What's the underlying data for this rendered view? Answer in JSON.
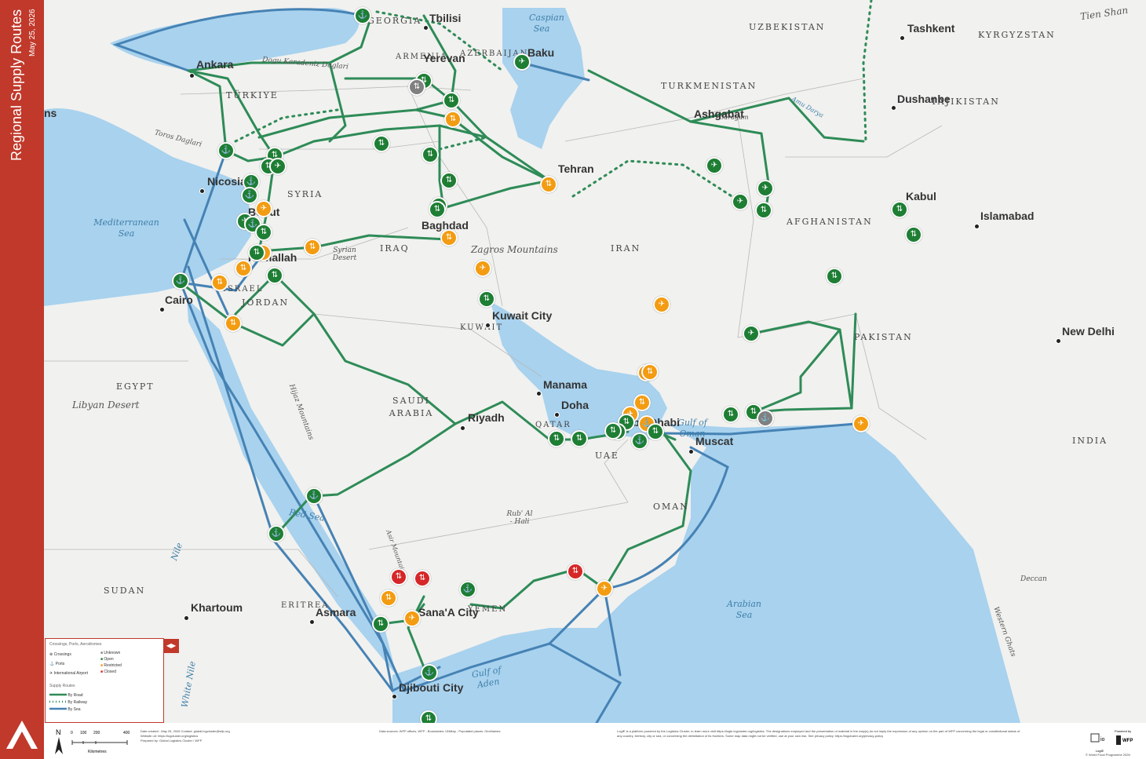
{
  "title": "Regional Supply Routes",
  "date": "May 25, 2026",
  "colors": {
    "road": "#2e8b57",
    "rail": "#2e8b57",
    "sea": "#4682b4",
    "open": "#1e7e34",
    "restricted": "#f39c12",
    "closed": "#d62728",
    "unknown": "#808080",
    "brand": "#c0392b",
    "water": "#a8d2ee",
    "land": "#f1f1ef"
  },
  "cities": [
    "Tbilisi",
    "Yerevan",
    "Baku",
    "Ankara",
    "Tashkent",
    "Dushanbe",
    "Ashgabat",
    "Tehran",
    "Kabul",
    "Islamabad",
    "Nicosia",
    "Beirut",
    "Ramallah",
    "Baghdad",
    "Cairo",
    "Kuwait City",
    "New Delhi",
    "Manama",
    "Doha",
    "Riyadh",
    "Abu Dhabi",
    "Muscat",
    "Khartoum",
    "Asmara",
    "Sana'A City",
    "Djibouti City"
  ],
  "countries": [
    "GEORGIA",
    "ARMENIA",
    "AZERBAIJAN",
    "UZBEKISTAN",
    "KYRGYZSTAN",
    "TURKMENISTAN",
    "TAJIKISTAN",
    "TÜRKIYE",
    "SYRIA",
    "IRAQ",
    "IRAN",
    "AFGHANISTAN",
    "PAKISTAN",
    "ISRAEL",
    "JORDAN",
    "KUWAIT",
    "EGYPT",
    "SAUDI ARABIA",
    "QATAR",
    "UAE",
    "OMAN",
    "INDIA",
    "SUDAN",
    "ERITREA",
    "YEMEN"
  ],
  "water_labels": [
    "Caspian Sea",
    "Mediterranean Sea",
    "Red Sea",
    "Gulf of Oman",
    "Arabian Sea",
    "Gulf of Aden",
    "Nile",
    "White Nile",
    "Amu Darya"
  ],
  "terrain_labels": [
    "Tien Shan",
    "Dogu Karadeniz Daglari",
    "Toros Daglari",
    "Syrian Desert",
    "Zagros Mountains",
    "Libyan Desert",
    "Hijaz Mountains",
    "Rub' Al - Hali",
    "Asir Mountains",
    "Deccan",
    "Western Ghats",
    "Garagum",
    "ns"
  ],
  "legend": {
    "section1": "Crossings, Ports, Aerodromes",
    "types": [
      "Crossings",
      "Ports",
      "International Airport"
    ],
    "statuses": [
      "Unknown",
      "Open",
      "Restricted",
      "Closed"
    ],
    "section2": "Supply Routes",
    "routes": [
      "By Road",
      "By Railway",
      "By Sea"
    ]
  },
  "scale": {
    "ticks": [
      "0",
      "100",
      "200",
      "400"
    ],
    "unit": "Kilometres",
    "north": "N"
  },
  "footer": {
    "created": "Date created : May 25, 2026 Contact: global.logcluster@wfp.org",
    "website": "Website url: https://logcluster.org/logistics",
    "prepared": "Prepared by: Global Logistics Cluster / WFP",
    "sources": "Data sources: WFP offices, WFP - Boundaries: UNMap - Populated places: GeoNames",
    "disclaimer1": "LogIE is a platform powered by the Logistics Cluster, to learn more visit https://logie.logcluster.org/logistics. The designations employed and the presentation of material in the map(s) do not imply the expression of any opinion on the part of WFP concerning the legal or constitutional status of",
    "disclaimer2": "any country, territory, city or sea, or concerning the delimitation of its frontiers. Some map data might not be verified, use at your own risk. See privacy policy: https://logcluster.org/privacy-policy",
    "logie": "LogIE",
    "powered": "Powered by",
    "partner": "WFP",
    "copyright": "© World Food Programme 2026"
  },
  "markers": [
    {
      "type": "port",
      "status": "open"
    },
    {
      "type": "crossing",
      "status": "open"
    },
    {
      "type": "crossing",
      "status": "unknown"
    },
    {
      "type": "crossing",
      "status": "open"
    },
    {
      "type": "crossing",
      "status": "restricted"
    },
    {
      "type": "port",
      "status": "open"
    },
    {
      "type": "crossing",
      "status": "open"
    },
    {
      "type": "crossing",
      "status": "open"
    },
    {
      "type": "airport",
      "status": "open"
    },
    {
      "type": "port",
      "status": "open"
    },
    {
      "type": "port",
      "status": "open"
    },
    {
      "type": "airport",
      "status": "open"
    },
    {
      "type": "port",
      "status": "open"
    },
    {
      "type": "airport",
      "status": "restricted"
    },
    {
      "type": "crossing",
      "status": "open"
    },
    {
      "type": "crossing",
      "status": "restricted"
    },
    {
      "type": "crossing",
      "status": "open"
    },
    {
      "type": "crossing",
      "status": "restricted"
    },
    {
      "type": "crossing",
      "status": "restricted"
    },
    {
      "type": "crossing",
      "status": "open"
    },
    {
      "type": "port",
      "status": "open"
    },
    {
      "type": "crossing",
      "status": "restricted"
    },
    {
      "type": "crossing",
      "status": "open"
    },
    {
      "type": "crossing",
      "status": "open"
    },
    {
      "type": "crossing",
      "status": "open"
    },
    {
      "type": "crossing",
      "status": "open"
    },
    {
      "type": "crossing",
      "status": "open"
    },
    {
      "type": "crossing",
      "status": "restricted"
    },
    {
      "type": "crossing",
      "status": "restricted"
    },
    {
      "type": "airport",
      "status": "restricted"
    },
    {
      "type": "airport",
      "status": "restricted"
    },
    {
      "type": "crossing",
      "status": "open"
    },
    {
      "type": "airport",
      "status": "open"
    },
    {
      "type": "airport",
      "status": "open"
    },
    {
      "type": "airport",
      "status": "open"
    },
    {
      "type": "airport",
      "status": "open"
    },
    {
      "type": "crossing",
      "status": "open"
    },
    {
      "type": "crossing",
      "status": "open"
    },
    {
      "type": "crossing",
      "status": "open"
    },
    {
      "type": "crossing",
      "status": "open"
    },
    {
      "type": "airport",
      "status": "open"
    },
    {
      "type": "crossing",
      "status": "open"
    },
    {
      "type": "port",
      "status": "unknown"
    },
    {
      "type": "crossing",
      "status": "open"
    },
    {
      "type": "airport",
      "status": "restricted"
    },
    {
      "type": "crossing",
      "status": "restricted"
    },
    {
      "type": "crossing",
      "status": "restricted"
    },
    {
      "type": "crossing",
      "status": "restricted"
    },
    {
      "type": "crossing",
      "status": "restricted"
    },
    {
      "type": "airport",
      "status": "restricted"
    },
    {
      "type": "crossing",
      "status": "open"
    },
    {
      "type": "port",
      "status": "open"
    },
    {
      "type": "crossing",
      "status": "open"
    },
    {
      "type": "port",
      "status": "restricted"
    },
    {
      "type": "crossing",
      "status": "open"
    },
    {
      "type": "crossing",
      "status": "open"
    },
    {
      "type": "crossing",
      "status": "open"
    },
    {
      "type": "port",
      "status": "open"
    },
    {
      "type": "port",
      "status": "open"
    },
    {
      "type": "port",
      "status": "open"
    },
    {
      "type": "crossing",
      "status": "open"
    },
    {
      "type": "crossing",
      "status": "closed"
    },
    {
      "type": "crossing",
      "status": "closed"
    },
    {
      "type": "crossing",
      "status": "closed"
    },
    {
      "type": "crossing",
      "status": "restricted"
    },
    {
      "type": "port",
      "status": "open"
    },
    {
      "type": "airport",
      "status": "restricted"
    },
    {
      "type": "airport",
      "status": "restricted"
    },
    {
      "type": "port",
      "status": "open"
    },
    {
      "type": "crossing",
      "status": "open"
    }
  ]
}
